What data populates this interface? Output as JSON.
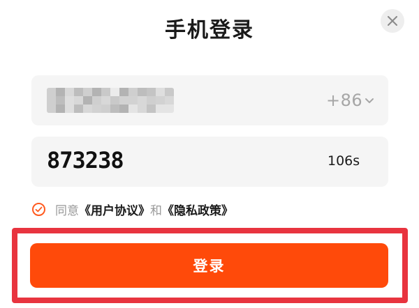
{
  "header": {
    "title": "手机登录",
    "close_icon": "close-icon"
  },
  "phone_field": {
    "country_code": "+86",
    "dropdown_icon": "chevron-down-icon",
    "value_masked": true
  },
  "code_field": {
    "value": "873238",
    "countdown": "106s"
  },
  "agreement": {
    "checked": true,
    "prefix": "同意",
    "user_agreement": "《用户协议》",
    "and": "和",
    "privacy_policy": "《隐私政策》"
  },
  "login_button": {
    "label": "登录"
  },
  "colors": {
    "accent": "#ff4a0a",
    "highlight_frame": "#e8343f",
    "field_background": "#f5f5f5"
  }
}
